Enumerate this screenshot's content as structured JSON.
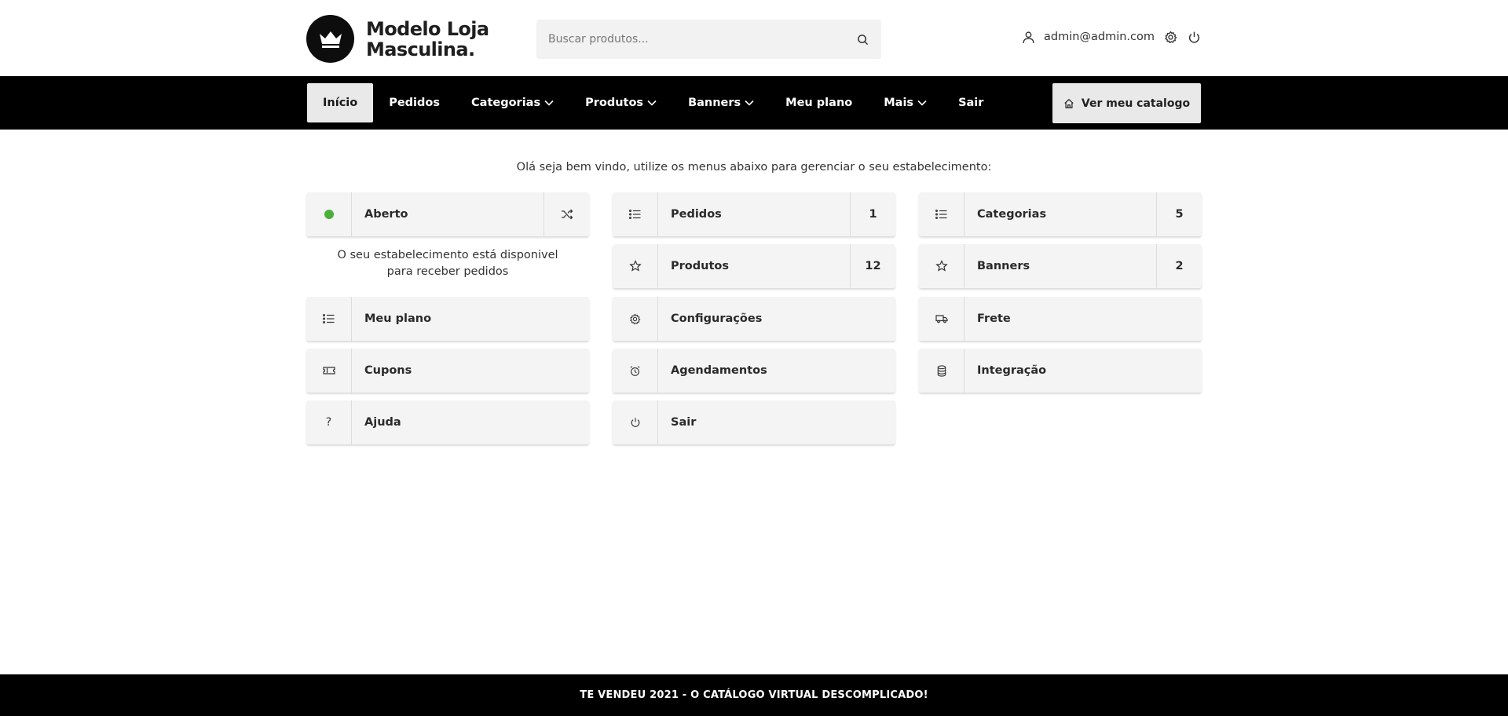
{
  "brand": {
    "name_line1": "Modelo Loja",
    "name_line2": "Masculina."
  },
  "search": {
    "placeholder": "Buscar produtos..."
  },
  "user": {
    "email": "admin@admin.com"
  },
  "nav": {
    "items": [
      {
        "label": "Início",
        "active": true
      },
      {
        "label": "Pedidos"
      },
      {
        "label": "Categorias",
        "dropdown": true
      },
      {
        "label": "Produtos",
        "dropdown": true
      },
      {
        "label": "Banners",
        "dropdown": true
      },
      {
        "label": "Meu plano"
      },
      {
        "label": "Mais",
        "dropdown": true
      },
      {
        "label": "Sair"
      }
    ],
    "catalog_button": "Ver meu catalogo"
  },
  "welcome": "Olá seja bem vindo, utilize os menus abaixo para gerenciar o seu estabelecimento:",
  "status": {
    "label": "Aberto",
    "color": "#4caf3a",
    "desc_line1": "O seu estabelecimento está disponivel",
    "desc_line2": "para receber pedidos"
  },
  "cards": {
    "pedidos": {
      "label": "Pedidos",
      "count": "1",
      "icon": "list-icon"
    },
    "categorias": {
      "label": "Categorias",
      "count": "5",
      "icon": "list-icon"
    },
    "produtos": {
      "label": "Produtos",
      "count": "12",
      "icon": "star-icon"
    },
    "banners": {
      "label": "Banners",
      "count": "2",
      "icon": "star-icon"
    },
    "meu_plano": {
      "label": "Meu plano",
      "icon": "list-icon"
    },
    "configuracoes": {
      "label": "Configurações",
      "icon": "gear-icon"
    },
    "frete": {
      "label": "Frete",
      "icon": "truck-icon"
    },
    "cupons": {
      "label": "Cupons",
      "icon": "ticket-icon"
    },
    "agendamentos": {
      "label": "Agendamentos",
      "icon": "alarm-clock-icon"
    },
    "integracao": {
      "label": "Integração",
      "icon": "database-icon"
    },
    "ajuda": {
      "label": "Ajuda",
      "icon": "question-icon"
    },
    "sair": {
      "label": "Sair",
      "icon": "power-icon"
    }
  },
  "footer": "TE VENDEU 2021 - O CATÁLOGO VIRTUAL DESCOMPLICADO!"
}
